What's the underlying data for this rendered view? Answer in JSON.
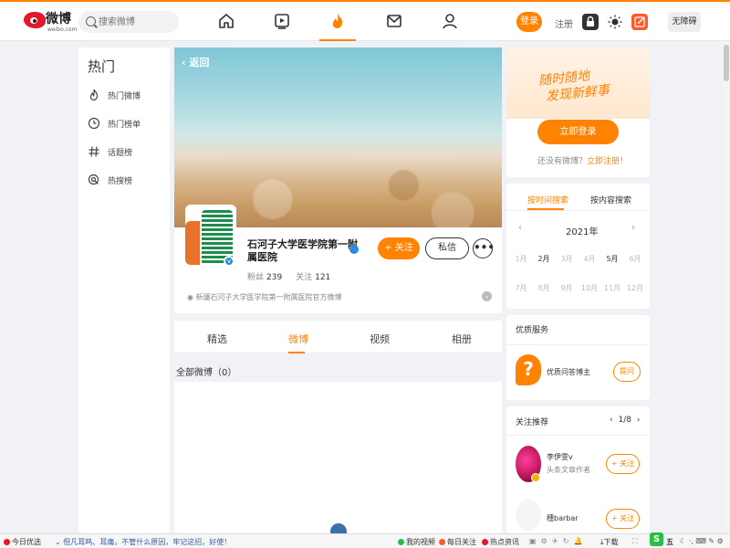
{
  "header": {
    "logo_text": "微博",
    "logo_sub": "weibo.com",
    "search_placeholder": "搜索微博",
    "nav_icons": [
      "home-icon",
      "video-icon",
      "hot-flame-icon",
      "mail-icon",
      "user-icon"
    ],
    "active_nav": "hot-flame-icon",
    "login_label": "登录",
    "register_label": "注册",
    "no_barrier_label": "无障碍"
  },
  "sidebar": {
    "title": "热门",
    "items": [
      {
        "icon": "flame-icon",
        "label": "热门微博"
      },
      {
        "icon": "clock-icon",
        "label": "热门榜单"
      },
      {
        "icon": "hashtag-icon",
        "label": "话题榜"
      },
      {
        "icon": "search-circle-icon",
        "label": "热搜榜"
      }
    ]
  },
  "profile": {
    "back_label": "返回",
    "name": "石河子大学医学院第一附属医院",
    "followers_label": "粉丝",
    "followers": "239",
    "following_label": "关注",
    "following": "121",
    "follow_button": "+ 关注",
    "message_button": "私信",
    "more_button": "•••",
    "description": "新疆石河子大学医学院第一附属医院官方微博",
    "tabs": [
      "精选",
      "微博",
      "视频",
      "相册"
    ],
    "active_tab": "微博",
    "all_posts_label": "全部微博（0）"
  },
  "promo": {
    "slogan_line1": "随时随地",
    "slogan_line2": "发现新鲜事",
    "login_now": "立即登录",
    "no_account_text": "还没有微博？",
    "register_link": "立即注册！"
  },
  "calendar": {
    "search_tabs": [
      "按时间搜索",
      "按内容搜索"
    ],
    "active_tab": "按时间搜索",
    "year": "2021年",
    "months": [
      "1月",
      "2月",
      "3月",
      "4月",
      "5月",
      "6月",
      "7月",
      "8月",
      "9月",
      "10月",
      "11月",
      "12月"
    ],
    "active_months": [
      "2月",
      "5月"
    ]
  },
  "service": {
    "title": "优质服务",
    "item_label": "优质问答博主",
    "ask_button": "提问"
  },
  "recommend": {
    "title": "关注推荐",
    "pager": "1/8",
    "users": [
      {
        "name": "李伊雯v",
        "subtitle": "头条文章作者",
        "follow": "+ 关注"
      },
      {
        "name": "穗barbar",
        "subtitle": "",
        "follow": "+ 关注"
      }
    ]
  },
  "taskbar": {
    "left_label": "今日优选",
    "news_text": "但凡耳鸣、耳痛，不管什么原因，牢记这招，好使！",
    "items": [
      "我的视频",
      "每日关注",
      "热点资讯"
    ],
    "download": "下载",
    "ime": "五"
  },
  "colors": {
    "accent": "#ff8200",
    "verify_blue": "#2b8ae2"
  }
}
